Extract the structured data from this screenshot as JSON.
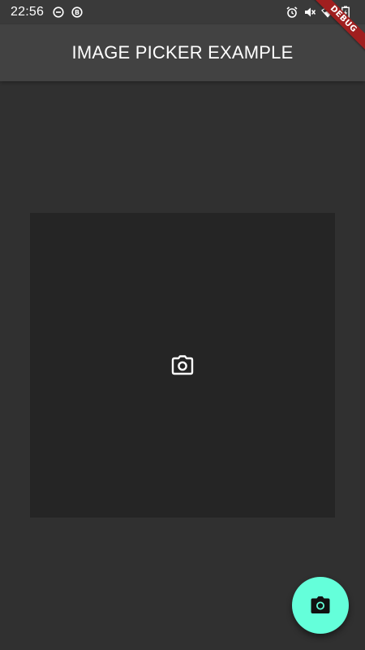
{
  "status_bar": {
    "time": "22:56",
    "left_icons": [
      "do-not-disturb-icon",
      "b-circle-icon"
    ],
    "right_icons": [
      "alarm-icon",
      "mute-icon",
      "wifi-icon",
      "battery-charging-icon"
    ]
  },
  "debug_banner": {
    "label": "DEBUG",
    "color": "#a01f1f"
  },
  "app_bar": {
    "title": "IMAGE PICKER EXAMPLE"
  },
  "picker": {
    "icon": "camera-outline-icon"
  },
  "fab": {
    "icon": "camera-icon",
    "color": "#64ffda"
  },
  "colors": {
    "background": "#303030",
    "app_bar": "#424242",
    "picker_box": "#252525"
  }
}
